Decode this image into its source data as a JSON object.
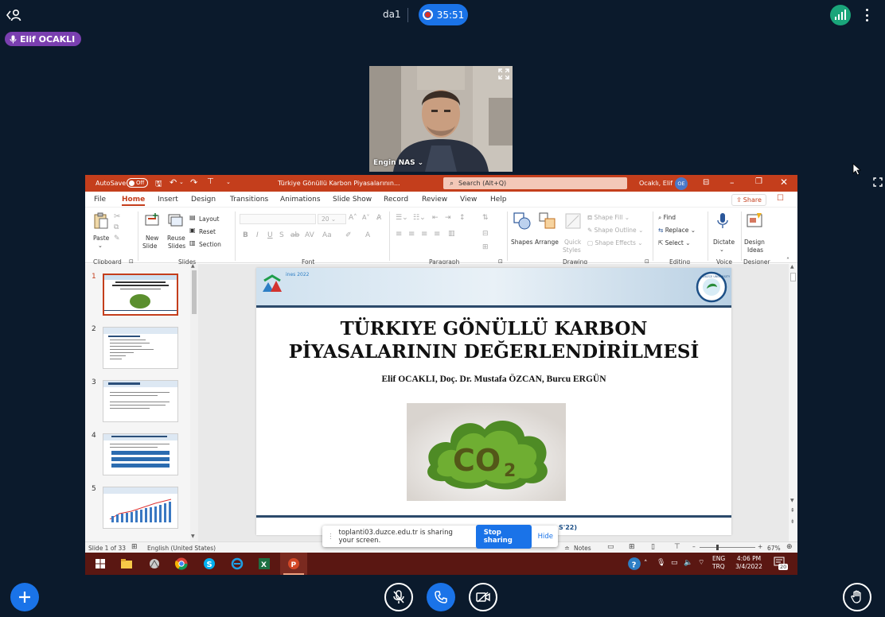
{
  "meeting": {
    "room_name": "da1",
    "timer": "35:51",
    "presenter_name": "Elif OCAKLI",
    "camera_participant": "Engin NAS",
    "colors": {
      "background": "#0b1a2c",
      "accent": "#1a73e8",
      "presenter_pill": "#7a3fb0",
      "signal": "#1aa57a"
    }
  },
  "ppt": {
    "autosave_label": "AutoSave",
    "autosave_state": "Off",
    "doc_title": "Türkiye Gönüllü Karbon Piyasalarının...",
    "search_placeholder": "Search (Alt+Q)",
    "user_name": "Ocaklı, Elif",
    "user_initials": "OE",
    "menu": [
      "File",
      "Home",
      "Insert",
      "Design",
      "Transitions",
      "Animations",
      "Slide Show",
      "Record",
      "Review",
      "View",
      "Help"
    ],
    "active_menu": "Home",
    "share_label": "Share",
    "ribbon": {
      "paste": "Paste",
      "clipboard": "Clipboard",
      "new_slide": "New",
      "new_slide2": "Slide",
      "reuse": "Reuse",
      "reuse2": "Slides",
      "layout": "Layout",
      "reset": "Reset",
      "section": "Section",
      "slides": "Slides",
      "font_size": "20",
      "font": "Font",
      "paragraph": "Paragraph",
      "shapes": "Shapes",
      "arrange": "Arrange",
      "quick": "Quick",
      "styles": "Styles",
      "shape_fill": "Shape Fill",
      "shape_outline": "Shape Outline",
      "shape_effects": "Shape Effects",
      "drawing": "Drawing",
      "find": "Find",
      "replace": "Replace",
      "select": "Select",
      "editing": "Editing",
      "dictate": "Dictate",
      "voice": "Voice",
      "design_ideas": "Design",
      "design_ideas2": "Ideas",
      "designer": "Designer"
    },
    "thumb_numbers": [
      "1",
      "2",
      "3",
      "4",
      "5"
    ],
    "slide": {
      "title_line1": "TÜRKIYE GÖNÜLLÜ KARBON",
      "title_line2": "PİYASALARININ DEĞERLENDİRİLMESİ",
      "authors": "Elif OCAKLI, Doç. Dr. Mustafa ÖZCAN, Burcu ERGÜN",
      "co2_text": "CO",
      "co2_sub": "2",
      "footer_partial": "S'22)",
      "logo_left_text": "ines 2022",
      "logo_right_text": "DUZCE UNIVERSITY"
    },
    "status": {
      "slide_count": "Slide 1 of 33",
      "language": "English (United States)",
      "notes": "Notes",
      "zoom": "67%"
    },
    "taskbar": {
      "lang1": "ENG",
      "lang2": "TRQ",
      "time": "4:06 PM",
      "date": "3/4/2022",
      "notif_count": "20"
    }
  },
  "share_bar": {
    "message": "toplanti03.duzce.edu.tr is sharing your screen.",
    "stop_label": "Stop sharing",
    "hide_label": "Hide"
  }
}
